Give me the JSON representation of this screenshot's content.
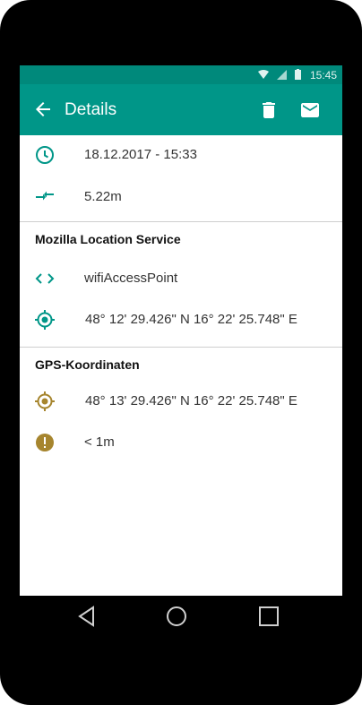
{
  "status_bar": {
    "time": "15:45"
  },
  "app_bar": {
    "title": "Details",
    "back_icon": "arrow-left-icon",
    "actions": [
      "delete-icon",
      "email-icon"
    ]
  },
  "colors": {
    "primary": "#009688",
    "primary_dark": "#00897B",
    "gps_accent": "#A6852E"
  },
  "summary": {
    "timestamp": "18.12.2017 - 15:33",
    "distance": "5.22m"
  },
  "mls": {
    "heading": "Mozilla Location Service",
    "source": "wifiAccessPoint",
    "coordinates": "48° 12' 29.426\" N 16° 22' 25.748\" E"
  },
  "gps": {
    "heading": "GPS-Koordinaten",
    "coordinates": "48° 13' 29.426\" N 16° 22' 25.748\" E",
    "accuracy": "< 1m"
  },
  "nav": [
    "back-triangle-icon",
    "home-circle-icon",
    "recents-square-icon"
  ]
}
